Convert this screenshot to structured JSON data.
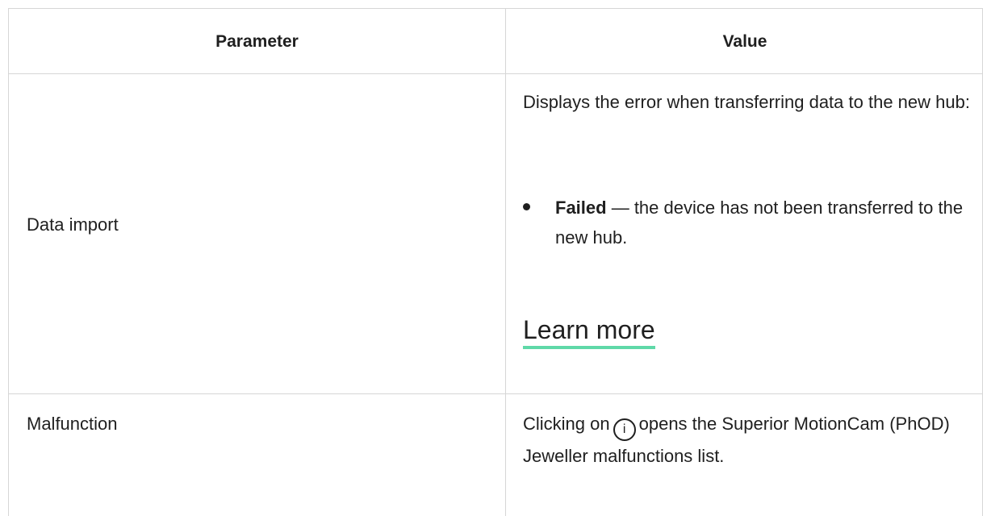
{
  "table": {
    "headers": {
      "parameter": "Parameter",
      "value": "Value"
    },
    "rows": [
      {
        "parameter": "Data import",
        "value_intro": "Displays the error when transferring data to the new hub:",
        "bullet": {
          "term": "Failed",
          "separator": " — ",
          "text": "the device has not been transferred to the new hub."
        },
        "link_label": "Learn more"
      },
      {
        "parameter": "Malfunction",
        "value_before_icon": "Clicking on",
        "icon": "info-icon",
        "icon_glyph": "i",
        "value_after_icon": "opens the Superior MotionCam (PhOD) Jeweller malfunctions list."
      }
    ]
  },
  "colors": {
    "text": "#1f1f1f",
    "border": "#d6d6d6",
    "link_underline": "#5fd9a8"
  }
}
